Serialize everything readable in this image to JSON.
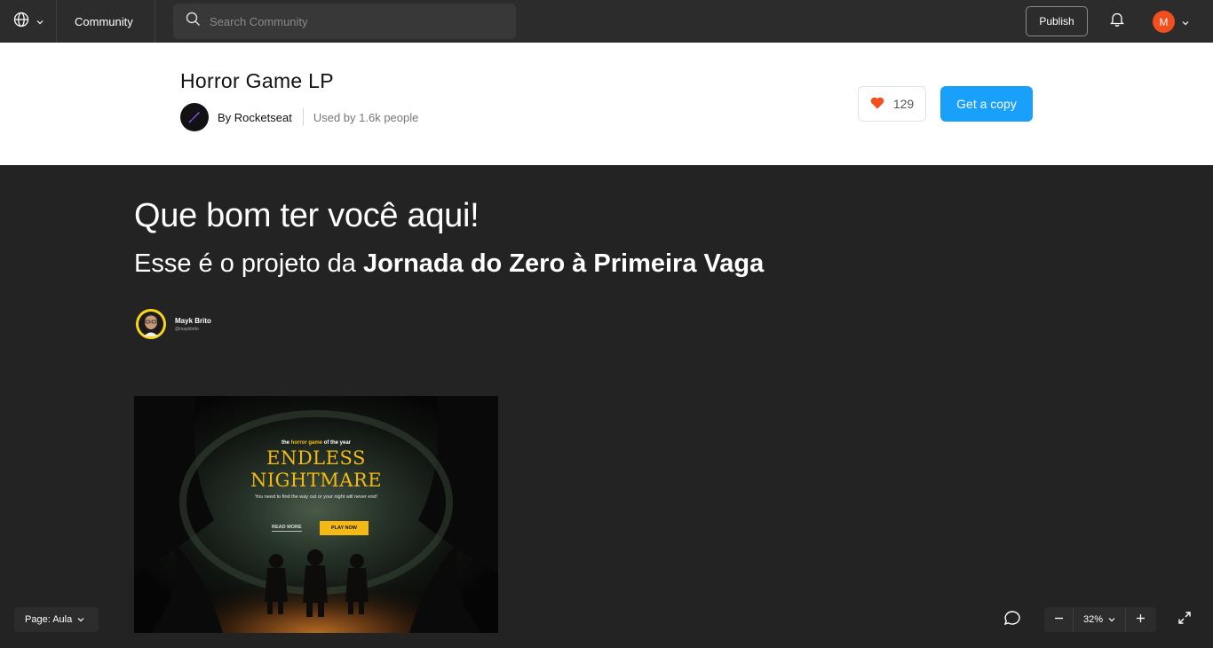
{
  "topbar": {
    "community_label": "Community",
    "search_placeholder": "Search Community",
    "publish_label": "Publish",
    "avatar_initial": "M"
  },
  "file": {
    "title": "Horror Game LP",
    "author": "By Rocketseat",
    "used_by": "Used by 1.6k people",
    "likes": "129",
    "copy_label": "Get a copy"
  },
  "canvas": {
    "hero_title": "Que bom ter você aqui!",
    "hero_sub_prefix": "Esse é o projeto da ",
    "hero_sub_bold": "Jornada do Zero à Primeira Vaga",
    "mentor_name": "Mayk Brito",
    "mentor_handle": "@maykbrito",
    "thumbnail": {
      "tagline_pre": "the ",
      "tagline_highlight": "horror game",
      "tagline_post": " of the year",
      "title_line1": "ENDLESS",
      "title_line2": "NIGHTMARE",
      "description": "You need to find the way out or your night will never end!",
      "read_more": "READ MORE",
      "play_now": "PLAY NOW"
    }
  },
  "bottom": {
    "page_label": "Page: Aula",
    "zoom": "32%"
  },
  "colors": {
    "accent_blue": "#18a0fb",
    "avatar_orange": "#f24e1e",
    "heart_red": "#f24e1e",
    "thumb_yellow": "#f5b915"
  }
}
